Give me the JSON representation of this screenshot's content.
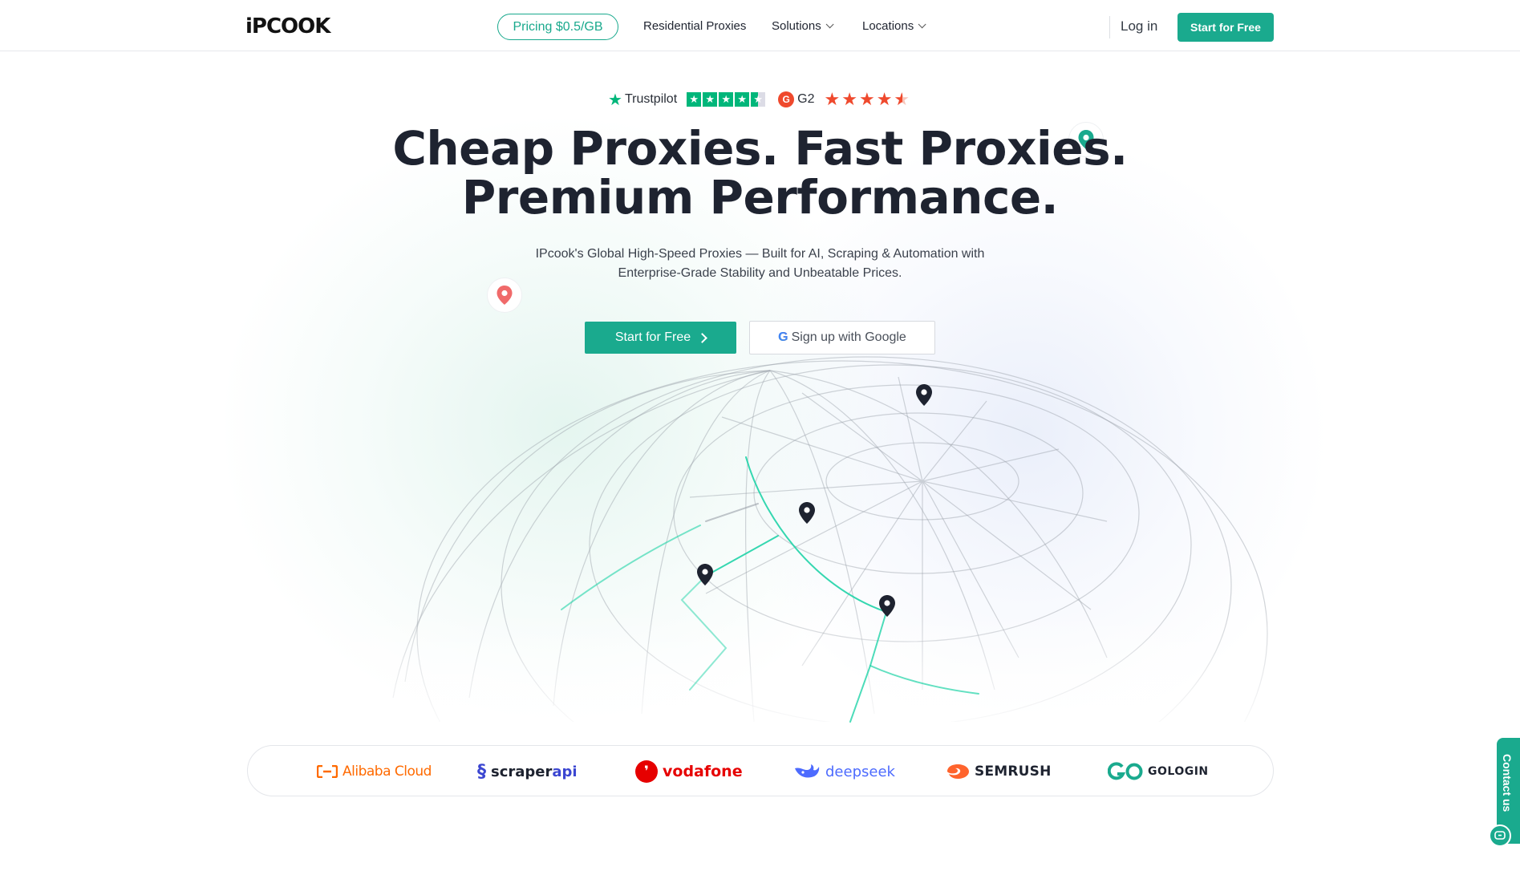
{
  "header": {
    "logo": "iPCOOK",
    "pricing_label": "Pricing $0.5/GB",
    "nav": [
      {
        "label": "Residential Proxies"
      },
      {
        "label": "Solutions"
      },
      {
        "label": "Locations"
      }
    ],
    "login_label": "Log in",
    "cta_label": "Start for Free"
  },
  "ratings": {
    "trustpilot_label": "Trustpilot",
    "trustpilot_stars": 4.5,
    "g2_label": "G2",
    "g2_stars": 4.5
  },
  "hero": {
    "headline_line1": "Cheap Proxies. Fast Proxies.",
    "headline_line2": "Premium Performance.",
    "sub_line1": "IPcook's Global High-Speed Proxies — Built for AI, Scraping & Automation with",
    "sub_line2": "Enterprise-Grade Stability and Unbeatable Prices.",
    "primary_cta": "Start for Free",
    "google_cta": "Sign up with Google"
  },
  "clients": [
    {
      "name": "Alibaba Cloud",
      "color": "#ff6a00"
    },
    {
      "name_a": "scraper",
      "name_b": "api",
      "color": "#3b46d1"
    },
    {
      "name": "vodafone",
      "color": "#e60000"
    },
    {
      "name": "deepseek",
      "color": "#4d6bfe"
    },
    {
      "name": "SEMRUSH",
      "color": "#ff642d"
    },
    {
      "name": "GOLOGIN",
      "color": "#1aaa8e"
    }
  ],
  "contact": {
    "label": "Contact us"
  },
  "colors": {
    "brand": "#1aaa8e",
    "text_dark": "#1e2330"
  }
}
